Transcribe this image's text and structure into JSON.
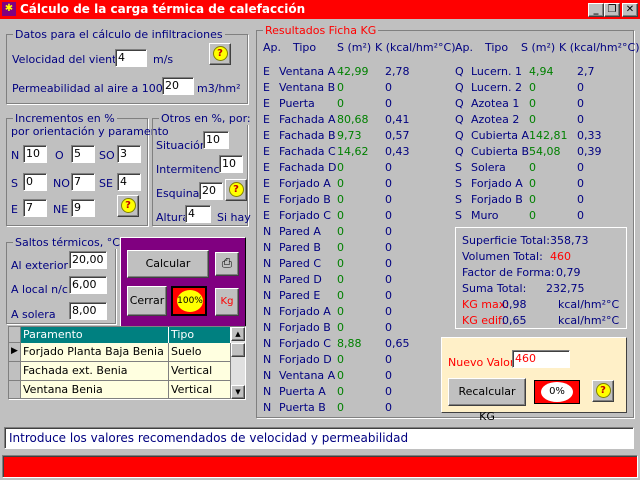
{
  "window": {
    "title": "Cálculo de la carga térmica de calefacción",
    "app_icon": "app-icon",
    "buttons": [
      "_",
      "❐",
      "✕"
    ]
  },
  "infiltracion": {
    "legend": "Datos para el cálculo de infiltraciones",
    "velocidad_label": "Velocidad del viento",
    "velocidad_value": "4",
    "velocidad_unit": "m/s",
    "permeabilidad_label": "Permeabilidad al aire a 100 Pa",
    "permeabilidad_value": "20",
    "permeabilidad_unit": "m3/hm²"
  },
  "incrementos": {
    "legend": "Incrementos en %",
    "subtitle": "por orientación y paramento",
    "fields": [
      {
        "label": "N",
        "value": "10"
      },
      {
        "label": "O",
        "value": "5"
      },
      {
        "label": "SO",
        "value": "3"
      },
      {
        "label": "S",
        "value": "0"
      },
      {
        "label": "NO",
        "value": "7"
      },
      {
        "label": "SE",
        "value": "4"
      },
      {
        "label": "E",
        "value": "7"
      },
      {
        "label": "NE",
        "value": "9"
      }
    ]
  },
  "otros": {
    "legend": "Otros en %, por:",
    "situacion_label": "Situación",
    "situacion_value": "10",
    "intermitencia_label": "Intermitencia",
    "intermitencia_value": "10",
    "esquina_label": "Esquina",
    "esquina_value": "20",
    "altura_label": "Altura",
    "altura_value": "4",
    "altura_suffix": "Si hay"
  },
  "saltos": {
    "legend": "Saltos térmicos, °C",
    "exterior_label": "Al exterior",
    "exterior_value": "20,00",
    "local_label": "A local n/c",
    "local_value": "6,00",
    "solera_label": "A solera",
    "solera_value": "8,00"
  },
  "actions": {
    "calcular": "Calcular",
    "cerrar": "Cerrar",
    "percent": "100%",
    "kg": "Kg",
    "print_icon": "printer-icon"
  },
  "grid": {
    "headers": [
      "Paramento",
      "Tipo"
    ],
    "rows": [
      [
        "Forjado Planta Baja Benia",
        "Suelo"
      ],
      [
        "Fachada ext. Benia",
        "Vertical"
      ],
      [
        "Ventana Benia",
        "Vertical"
      ]
    ]
  },
  "results": {
    "legend": "Resultados Ficha KG",
    "headers_left": [
      "Ap.",
      "Tipo",
      "S (m²)",
      "K (kcal/hm²°C)"
    ],
    "headers_right": [
      "Ap.",
      "Tipo",
      "S (m²)",
      "K (kcal/hm²°C)"
    ],
    "left": [
      [
        "E",
        "Ventana A",
        "42,99",
        "2,78"
      ],
      [
        "E",
        "Ventana B",
        "0",
        "0"
      ],
      [
        "E",
        "Puerta",
        "0",
        "0"
      ],
      [
        "E",
        "Fachada A",
        "80,68",
        "0,41"
      ],
      [
        "E",
        "Fachada B",
        "9,73",
        "0,57"
      ],
      [
        "E",
        "Fachada C",
        "14,62",
        "0,43"
      ],
      [
        "E",
        "Fachada D",
        "0",
        "0"
      ],
      [
        "E",
        "Forjado A",
        "0",
        "0"
      ],
      [
        "E",
        "Forjado B",
        "0",
        "0"
      ],
      [
        "E",
        "Forjado C",
        "0",
        "0"
      ],
      [
        "N",
        "Pared A",
        "0",
        "0"
      ],
      [
        "N",
        "Pared B",
        "0",
        "0"
      ],
      [
        "N",
        "Pared C",
        "0",
        "0"
      ],
      [
        "N",
        "Pared D",
        "0",
        "0"
      ],
      [
        "N",
        "Pared E",
        "0",
        "0"
      ],
      [
        "N",
        "Forjado A",
        "0",
        "0"
      ],
      [
        "N",
        "Forjado B",
        "0",
        "0"
      ],
      [
        "N",
        "Forjado C",
        "8,88",
        "0,65"
      ],
      [
        "N",
        "Forjado D",
        "0",
        "0"
      ],
      [
        "N",
        "Ventana A",
        "0",
        "0"
      ],
      [
        "N",
        "Puerta A",
        "0",
        "0"
      ],
      [
        "N",
        "Puerta B",
        "0",
        "0"
      ]
    ],
    "right": [
      [
        "Q",
        "Lucern. 1",
        "4,94",
        "2,7"
      ],
      [
        "Q",
        "Lucern. 2",
        "0",
        "0"
      ],
      [
        "Q",
        "Azotea 1",
        "0",
        "0"
      ],
      [
        "Q",
        "Azotea 2",
        "0",
        "0"
      ],
      [
        "Q",
        "Cubierta A",
        "142,81",
        "0,33"
      ],
      [
        "Q",
        "Cubierta B",
        "54,08",
        "0,39"
      ],
      [
        "S",
        "Solera",
        "0",
        "0"
      ],
      [
        "S",
        "Forjado A",
        "0",
        "0"
      ],
      [
        "S",
        "Forjado B",
        "0",
        "0"
      ],
      [
        "S",
        "Muro",
        "0",
        "0"
      ]
    ]
  },
  "summary": {
    "superficie_label": "Superficie Total:",
    "superficie_value": "358,73",
    "volumen_label": "Volumen Total:",
    "volumen_value": "460",
    "forma_label": "Factor de Forma:",
    "forma_value": "0,79",
    "suma_label": "Suma Total:",
    "suma_value": "232,75",
    "kgmax_label": "KG max:",
    "kgmax_value": "0,98",
    "kgmax_unit": "kcal/hm²°C",
    "kgedif_label": "KG edif:",
    "kgedif_value": "0,65",
    "kgedif_unit": "kcal/hm²°C"
  },
  "recalc": {
    "nuevo_label": "Nuevo Valor:",
    "nuevo_value": "460",
    "button": "Recalcular KG",
    "percent": "0%"
  },
  "status": {
    "text": "Introduce los valores recomendados de velocidad y permeabilidad"
  },
  "colors": {
    "title": "#ff0000",
    "label": "#000080",
    "value": "#008000",
    "accent": "#800080",
    "grid_header": "#008080"
  }
}
